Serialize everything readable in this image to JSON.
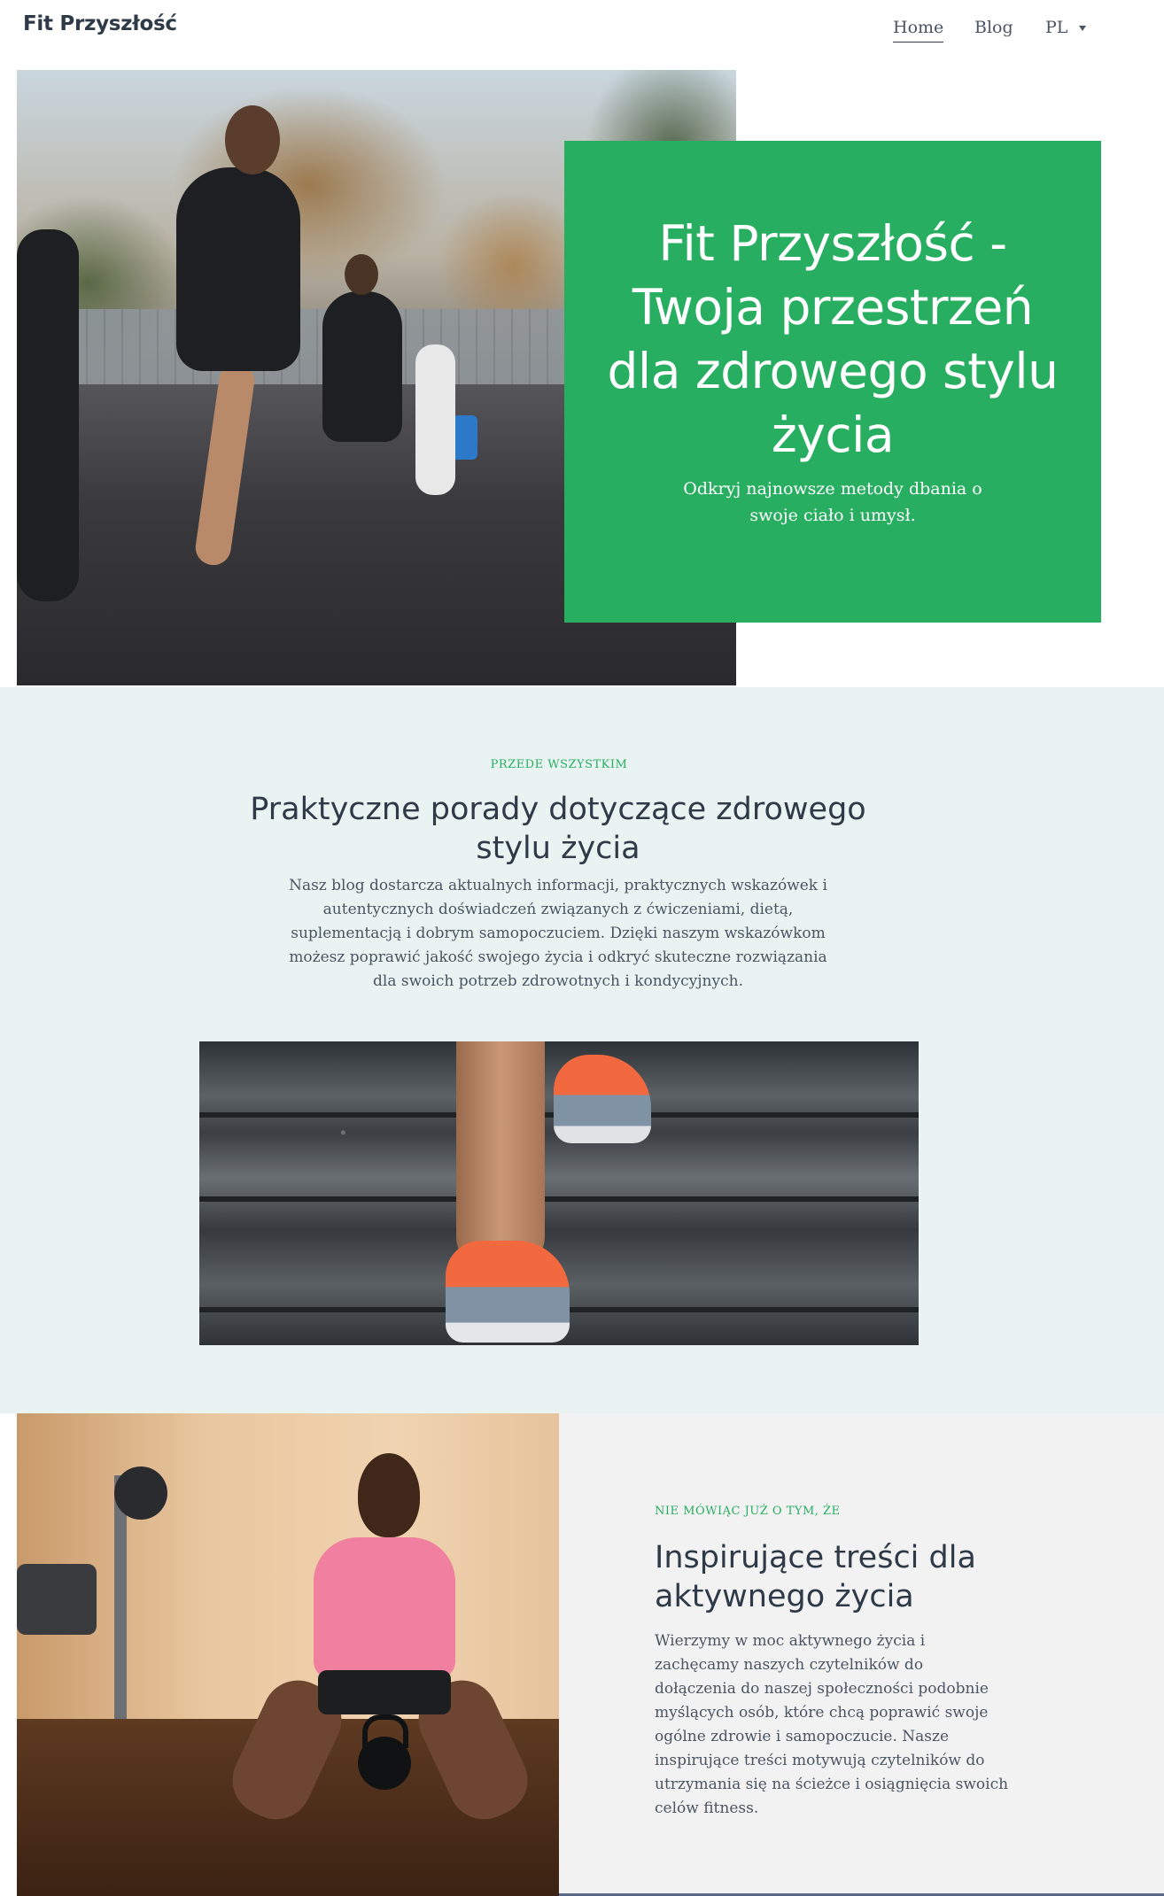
{
  "header": {
    "brand": "Fit Przyszłość",
    "nav": {
      "home": "Home",
      "blog": "Blog",
      "language": "PL"
    }
  },
  "hero": {
    "title": "Fit Przyszłość - Twoja przestrzeń dla zdrowego stylu życia",
    "subtitle": "Odkryj najnowsze metody dbania o swoje ciało i umysł.",
    "card_color": "#27ae60"
  },
  "section_tips": {
    "eyebrow": "PRZEDE WSZYSTKIM",
    "title": "Praktyczne porady dotyczące zdrowego stylu życia",
    "text": "Nasz blog dostarcza aktualnych informacji, praktycznych wskazówek i autentycznych doświadczeń związanych z ćwiczeniami, dietą, suplementacją i dobrym samopoczuciem. Dzięki naszym wskazówkom możesz poprawić jakość swojego życia i odkryć skuteczne rozwiązania dla swoich potrzeb zdrowotnych i kondycyjnych.",
    "background": "#e8f3f2"
  },
  "section_inspire": {
    "eyebrow": "NIE MÓWIĄC JUŻ O TYM, ŻE",
    "title": "Inspirujące treści dla aktywnego życia",
    "text": "Wierzymy w moc aktywnego życia i zachęcamy naszych czytelników do dołączenia do naszej społeczności podobnie myślących osób, które chcą poprawić swoje ogólne zdrowie i samopoczucie. Nasze inspirujące treści motywują czytelników do utrzymania się na ścieżce i osiągnięcia swoich celów fitness."
  }
}
